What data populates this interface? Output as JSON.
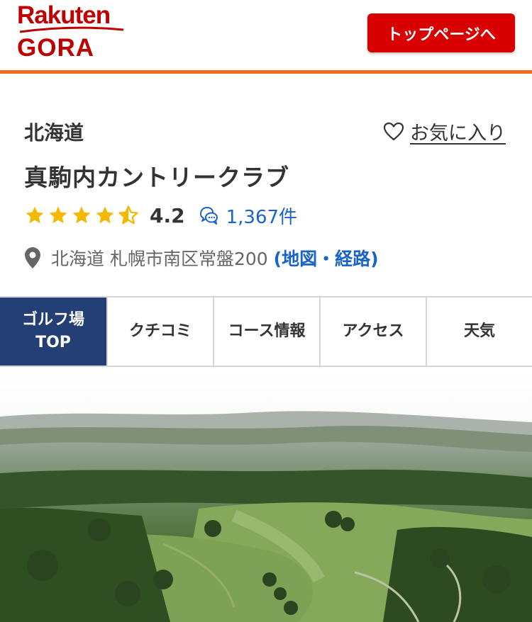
{
  "header": {
    "logo_line1": "Rakuten",
    "logo_line2": "GORA",
    "top_button_label": "トップページへ",
    "accent_color": "#bf0000",
    "border_color": "#ee6a1c"
  },
  "course": {
    "region": "北海道",
    "favorite_label": "お気に入り",
    "name": "真駒内カントリークラブ",
    "rating": "4.2",
    "rating_stars": 4.5,
    "review_count": "1,367件",
    "address": "北海道 札幌市南区常盤200",
    "map_link": "(地図・経路)"
  },
  "tabs": [
    {
      "line1": "ゴルフ場",
      "line2": "TOP",
      "active": true
    },
    {
      "label": "クチコミ"
    },
    {
      "label": "コース情報"
    },
    {
      "label": "アクセス"
    },
    {
      "label": "天気"
    }
  ],
  "icons": {
    "favorite": "heart-outline-icon",
    "review": "chat-bubbles-icon",
    "location": "map-pin-icon",
    "star": "star-icon"
  },
  "colors": {
    "star": "#f5b800",
    "link": "#1a64c9",
    "active_tab": "#233f73"
  }
}
